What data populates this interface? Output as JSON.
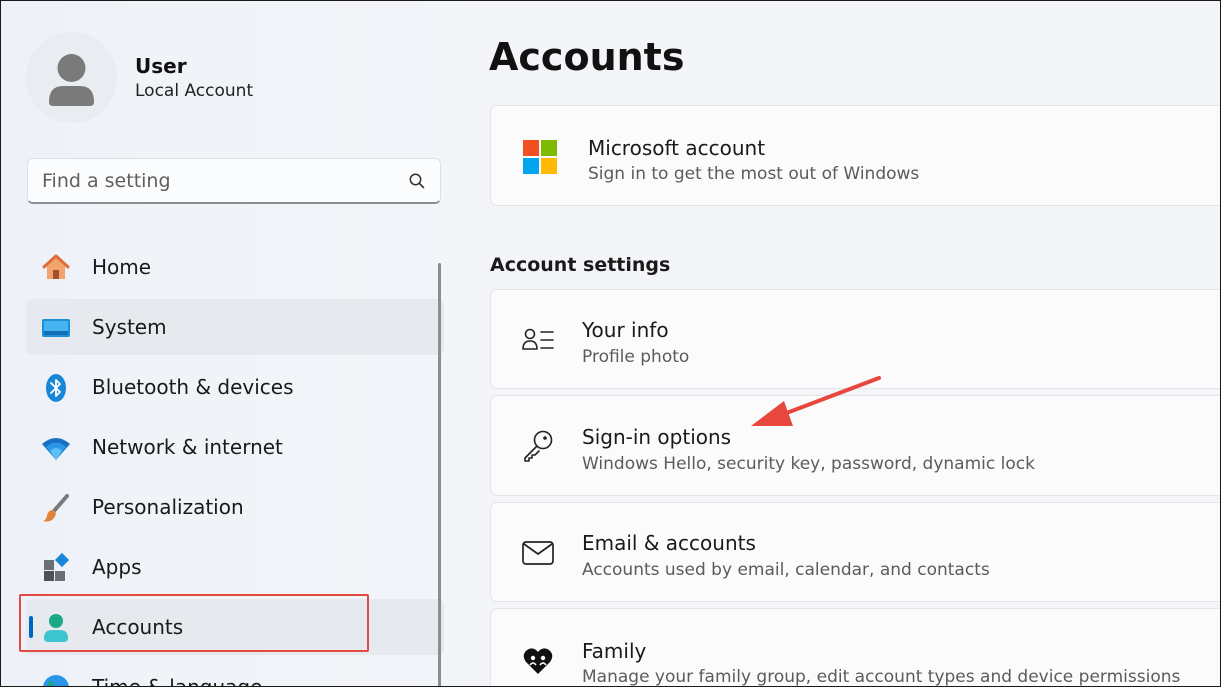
{
  "user": {
    "name": "User",
    "account_type": "Local Account"
  },
  "search": {
    "placeholder": "Find a setting"
  },
  "sidebar": {
    "items": [
      {
        "label": "Home",
        "icon": "home-icon"
      },
      {
        "label": "System",
        "icon": "system-icon"
      },
      {
        "label": "Bluetooth & devices",
        "icon": "bluetooth-icon"
      },
      {
        "label": "Network & internet",
        "icon": "wifi-icon"
      },
      {
        "label": "Personalization",
        "icon": "brush-icon"
      },
      {
        "label": "Apps",
        "icon": "apps-icon"
      },
      {
        "label": "Accounts",
        "icon": "accounts-icon",
        "selected": true
      },
      {
        "label": "Time & language",
        "icon": "globe-icon"
      }
    ]
  },
  "main": {
    "title": "Accounts",
    "microsoft_account": {
      "title": "Microsoft account",
      "subtitle": "Sign in to get the most out of Windows"
    },
    "section_title": "Account settings",
    "settings": [
      {
        "title": "Your info",
        "subtitle": "Profile photo",
        "icon": "person-list-icon"
      },
      {
        "title": "Sign-in options",
        "subtitle": "Windows Hello, security key, password, dynamic lock",
        "icon": "key-icon"
      },
      {
        "title": "Email & accounts",
        "subtitle": "Accounts used by email, calendar, and contacts",
        "icon": "mail-icon"
      },
      {
        "title": "Family",
        "subtitle": "Manage your family group, edit account types and device permissions",
        "icon": "family-heart-icon"
      }
    ]
  },
  "colors": {
    "accent": "#0067c0",
    "highlight": "#e24b43",
    "annotation_arrow": "#e8473e"
  }
}
